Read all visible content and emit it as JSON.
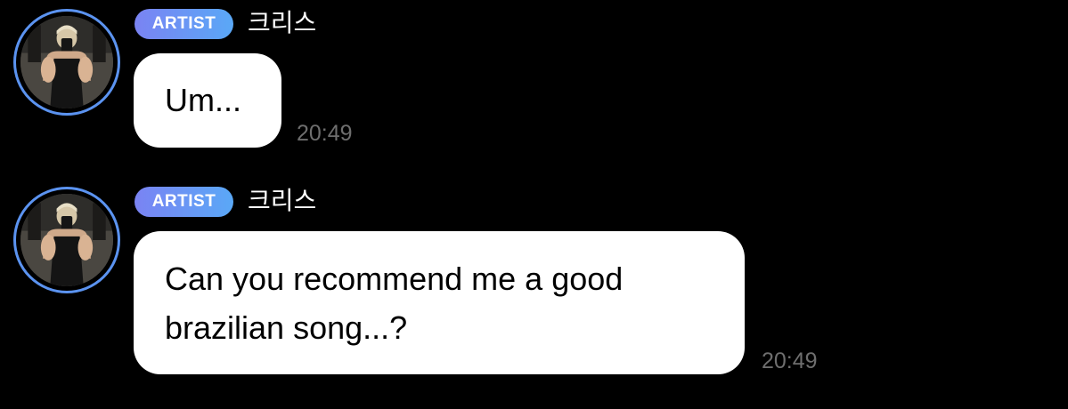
{
  "messages": [
    {
      "badge": "ARTIST",
      "sender": "크리스",
      "text": "Um...",
      "time": "20:49"
    },
    {
      "badge": "ARTIST",
      "sender": "크리스",
      "text_line1": "Can you recommend me a good",
      "text_line2": "brazilian song...?",
      "time": "20:49"
    }
  ],
  "colors": {
    "background": "#000000",
    "bubble": "#ffffff",
    "badge_gradient_start": "#7a83f3",
    "badge_gradient_end": "#5aa8f6",
    "avatar_ring": "#5b93f0",
    "timestamp": "#6e6e6e"
  },
  "icons": {
    "avatar": "profile-photo"
  }
}
